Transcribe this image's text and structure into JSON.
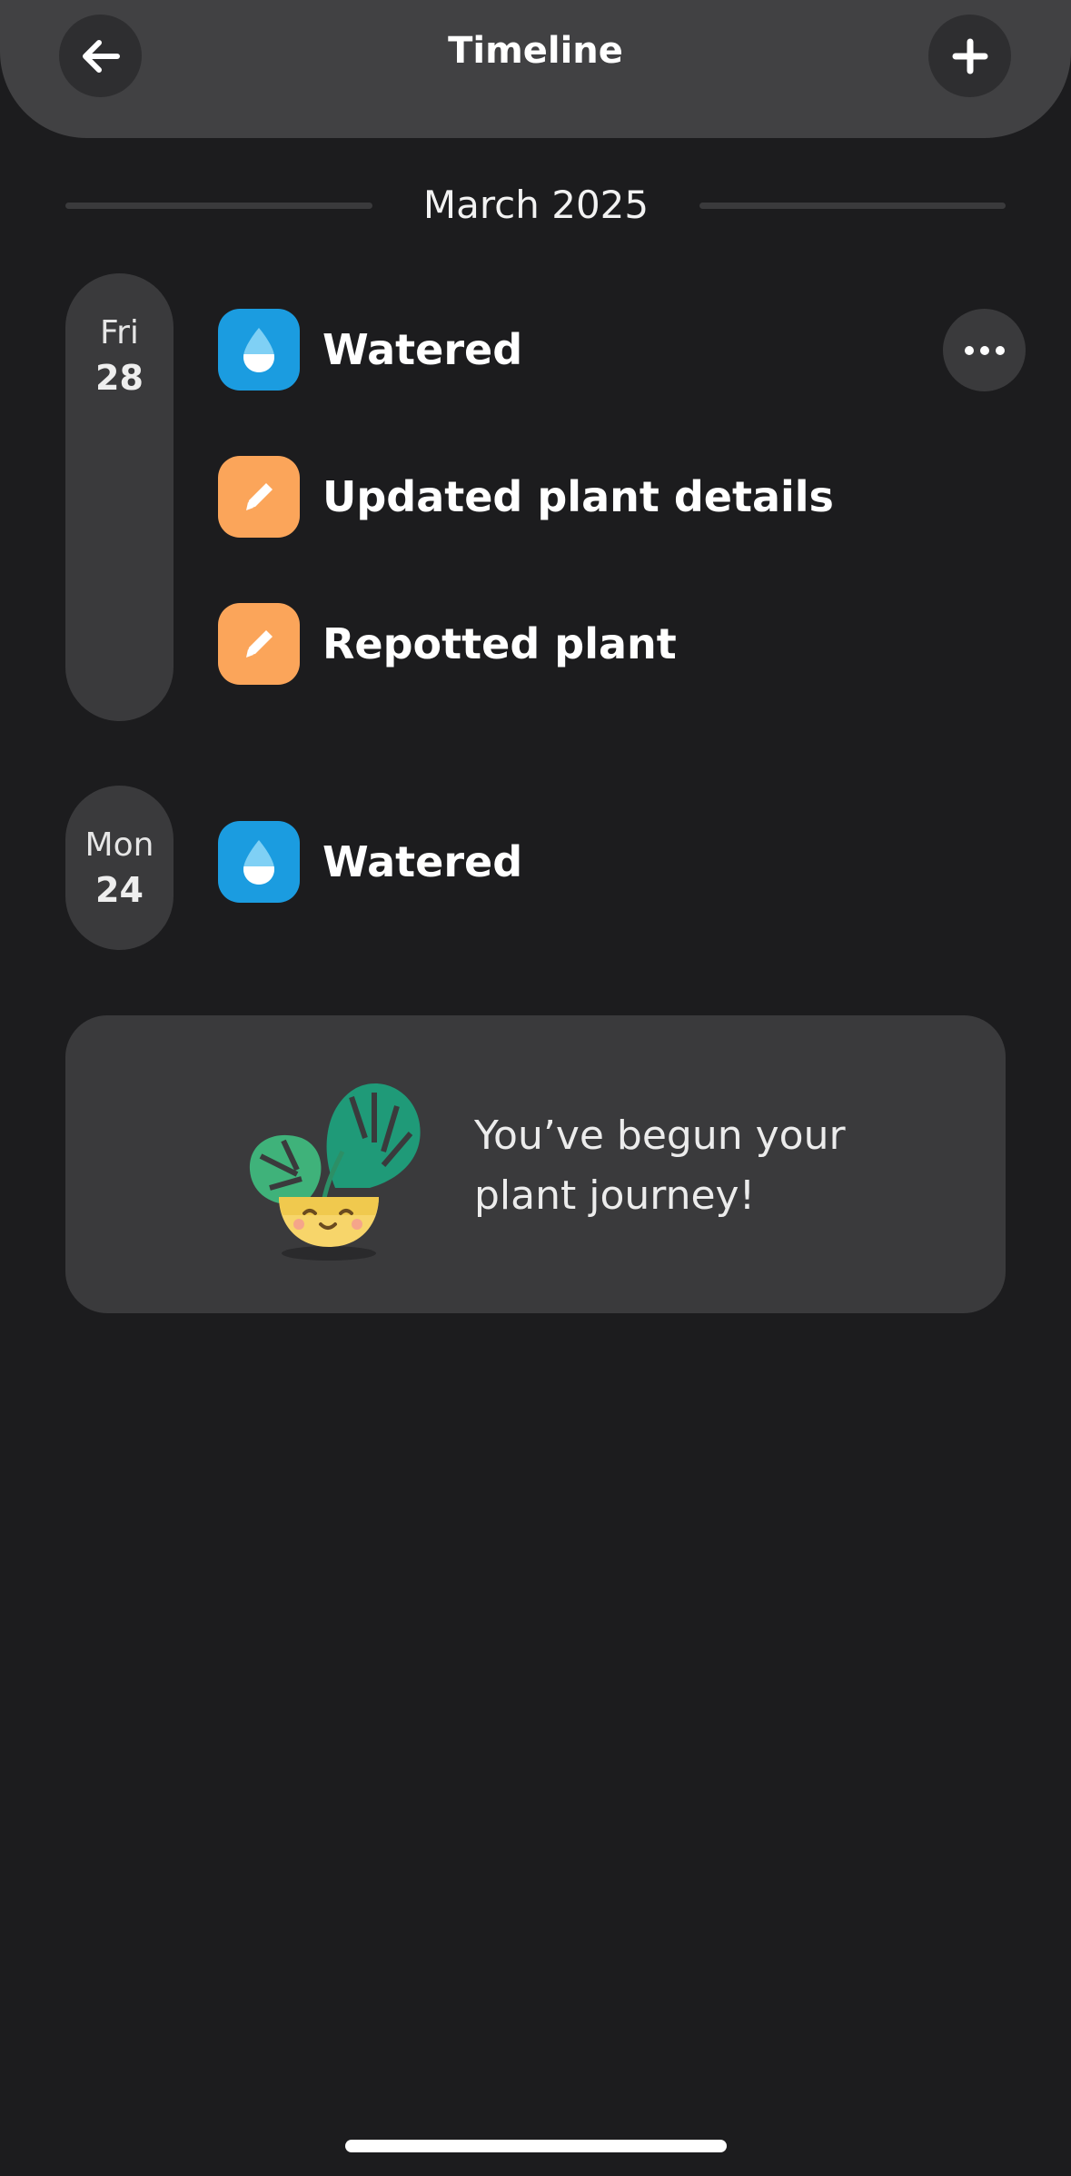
{
  "header": {
    "title": "Timeline",
    "back_icon": "arrow-left-icon",
    "add_icon": "plus-icon"
  },
  "month": {
    "label": "March 2025"
  },
  "days": [
    {
      "weekday": "Fri",
      "day": "28",
      "events": [
        {
          "label": "Watered",
          "icon": "water-drop-icon",
          "color": "#1b9ce0"
        },
        {
          "label": "Updated plant details",
          "icon": "pencil-icon",
          "color": "#fba55a"
        },
        {
          "label": "Repotted plant",
          "icon": "pencil-icon",
          "color": "#fba55a"
        }
      ]
    },
    {
      "weekday": "Mon",
      "day": "24",
      "events": [
        {
          "label": "Watered",
          "icon": "water-drop-icon",
          "color": "#1b9ce0"
        }
      ]
    }
  ],
  "more_icon": "more-dots-icon",
  "journey": {
    "text": "You’ve begun your plant journey!",
    "illustration": "happy-plant-illustration"
  },
  "colors": {
    "background": "#1c1c1e",
    "header": "#414143",
    "card": "#3a3a3c",
    "water": "#1b9ce0",
    "edit": "#fba55a"
  }
}
